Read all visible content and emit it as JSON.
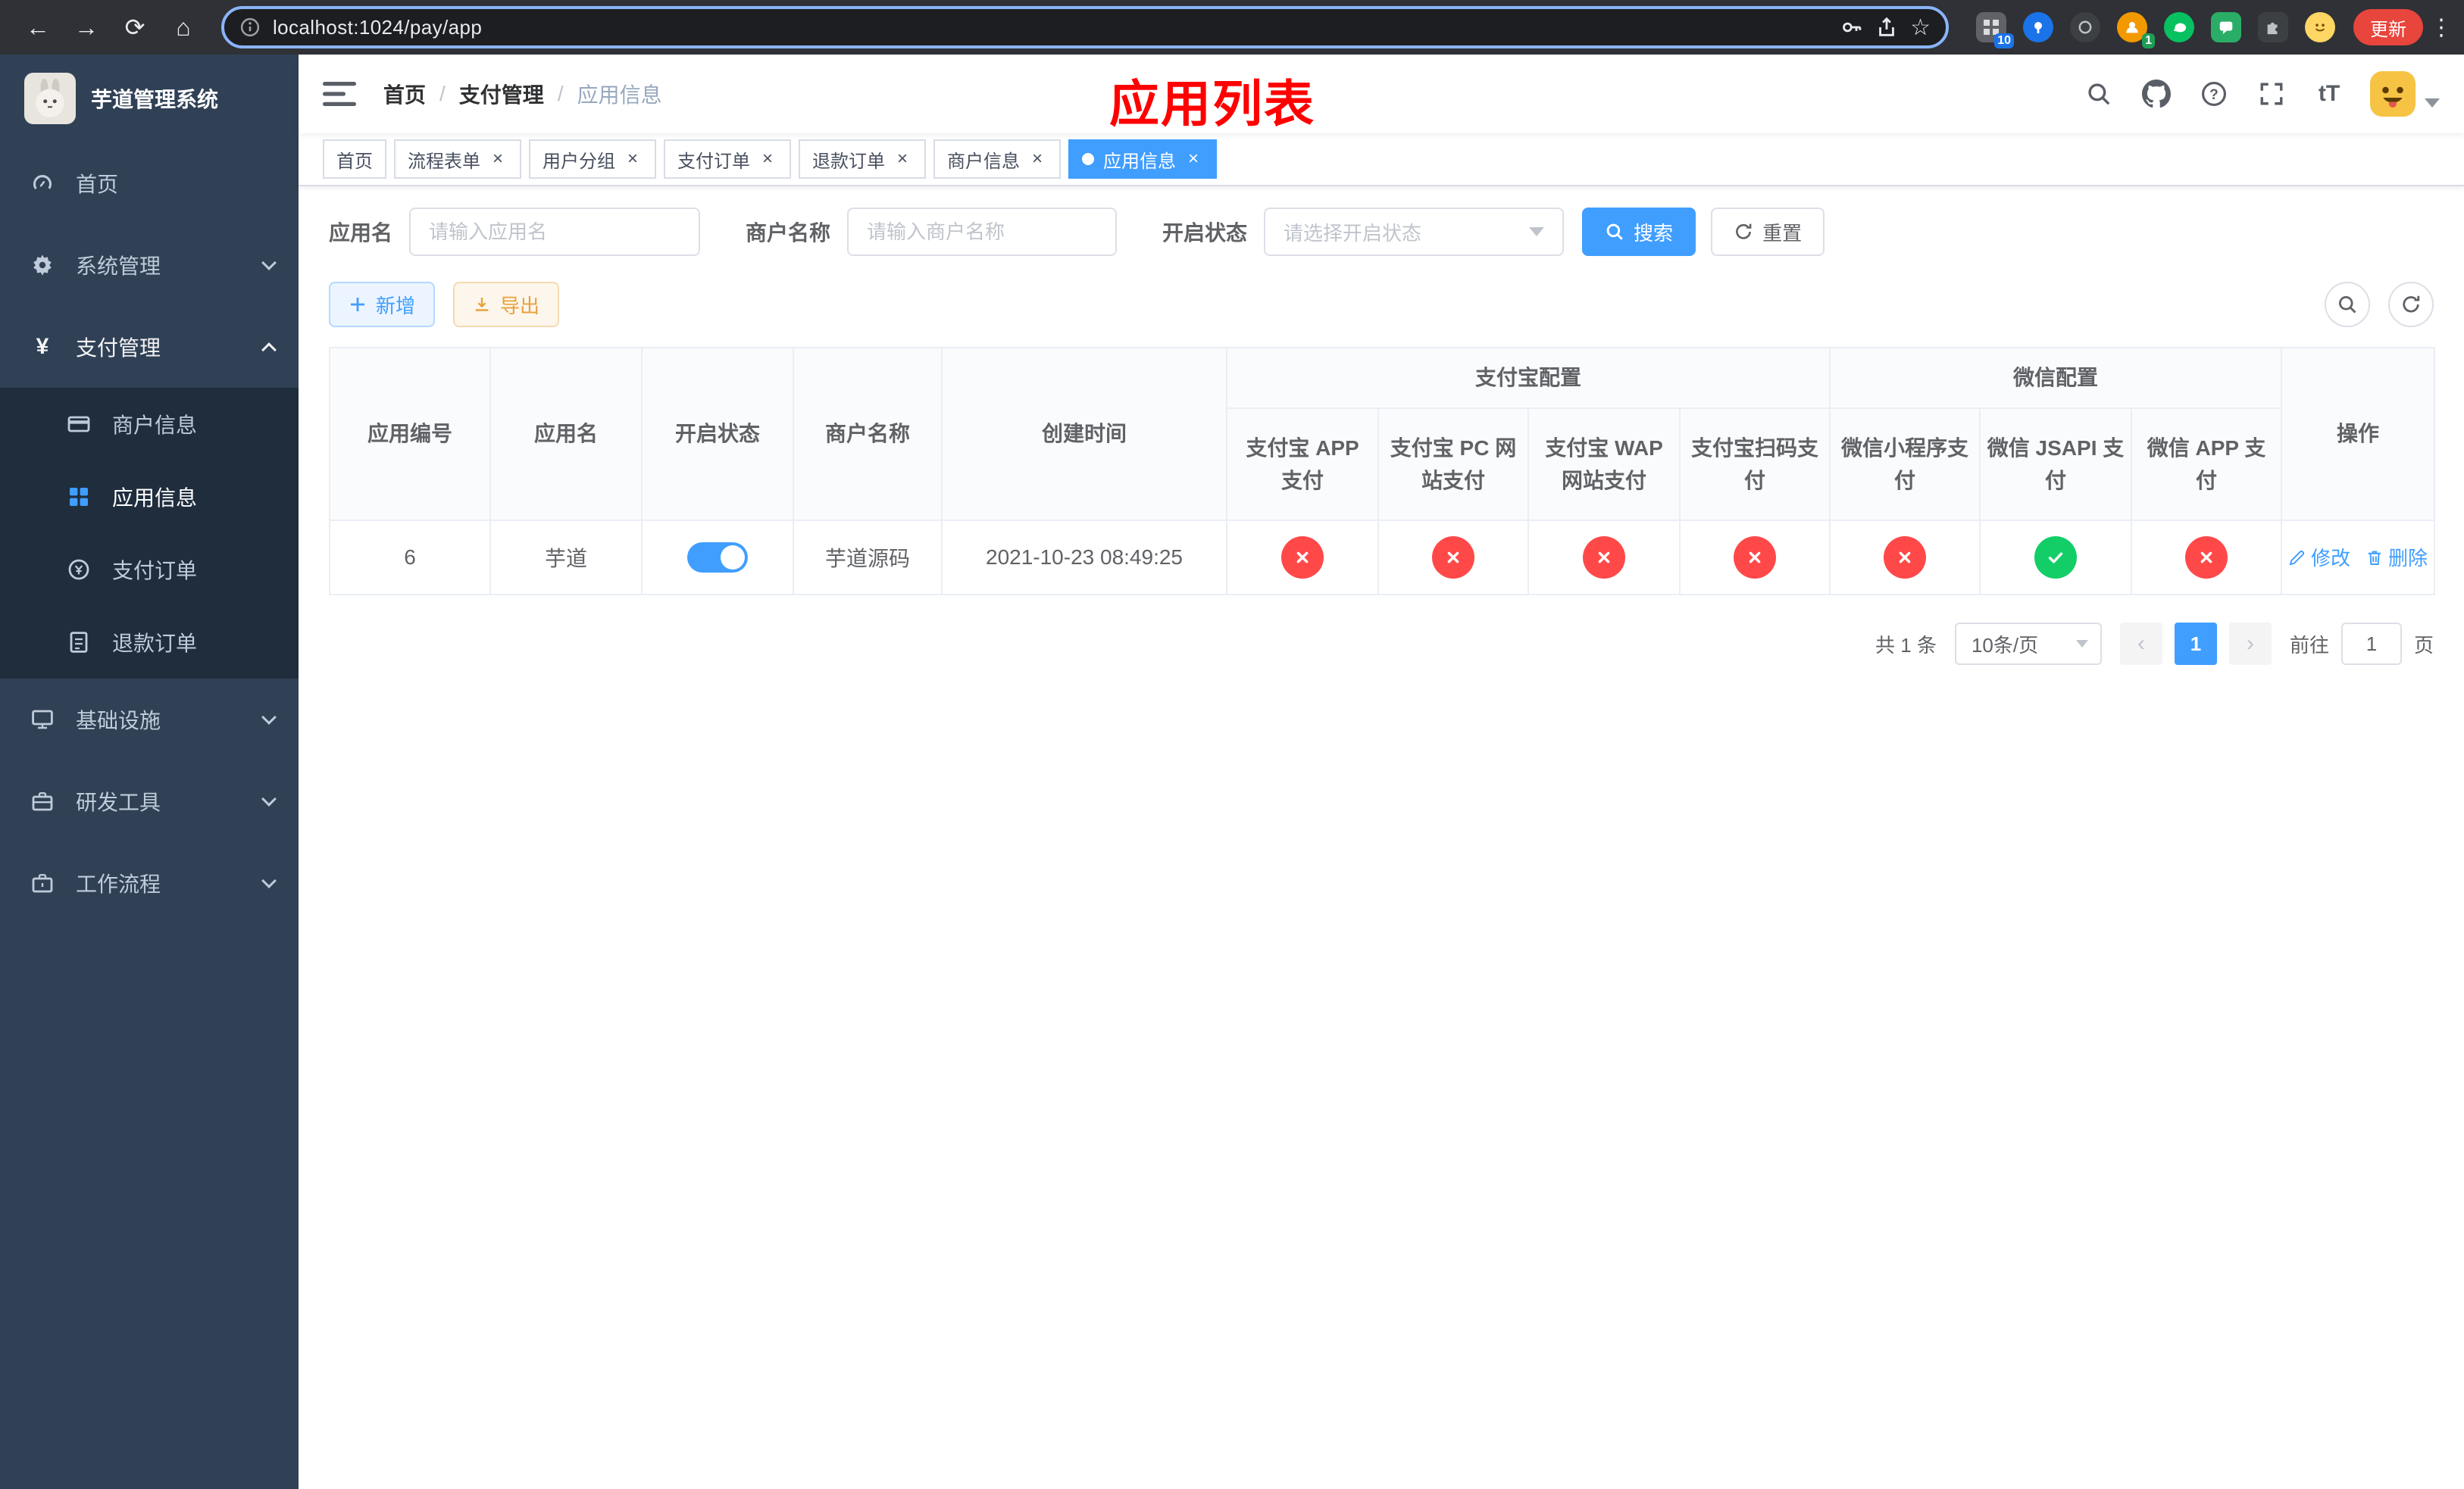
{
  "colors": {
    "accent": "#409eff",
    "danger": "#ff4949",
    "success": "#13ce66",
    "warning": "#e6a23c",
    "annotation": "#ff0000",
    "sidebar_bg": "#304156",
    "submenu_bg": "#1f2d3d"
  },
  "browser": {
    "url": "localhost:1024/pay/app",
    "update_label": "更新",
    "ext_badge_1": "10",
    "ext_badge_2": "1"
  },
  "sidebar": {
    "logo_title": "芋道管理系统",
    "items": [
      {
        "label": "首页"
      },
      {
        "label": "系统管理"
      },
      {
        "label": "支付管理",
        "children": [
          {
            "label": "商户信息"
          },
          {
            "label": "应用信息"
          },
          {
            "label": "支付订单"
          },
          {
            "label": "退款订单"
          }
        ]
      },
      {
        "label": "基础设施"
      },
      {
        "label": "研发工具"
      },
      {
        "label": "工作流程"
      }
    ]
  },
  "navbar": {
    "breadcrumb": [
      "首页",
      "支付管理",
      "应用信息"
    ],
    "annotation": "应用列表"
  },
  "tabs": [
    {
      "label": "首页"
    },
    {
      "label": "流程表单"
    },
    {
      "label": "用户分组"
    },
    {
      "label": "支付订单"
    },
    {
      "label": "退款订单"
    },
    {
      "label": "商户信息"
    },
    {
      "label": "应用信息"
    }
  ],
  "filters": {
    "app_name_label": "应用名",
    "app_name_placeholder": "请输入应用名",
    "merchant_label": "商户名称",
    "merchant_placeholder": "请输入商户名称",
    "status_label": "开启状态",
    "status_placeholder": "请选择开启状态",
    "search_label": "搜索",
    "reset_label": "重置"
  },
  "toolbar": {
    "add_label": "新增",
    "export_label": "导出"
  },
  "table": {
    "group_headers": {
      "alipay": "支付宝配置",
      "wechat": "微信配置"
    },
    "columns": [
      "应用编号",
      "应用名",
      "开启状态",
      "商户名称",
      "创建时间",
      "支付宝 APP 支付",
      "支付宝 PC 网站支付",
      "支付宝 WAP 网站支付",
      "支付宝扫码支付",
      "微信小程序支付",
      "微信 JSAPI 支付",
      "微信 APP 支付",
      "操作"
    ],
    "rows": [
      {
        "id": "6",
        "name": "芋道",
        "enabled": true,
        "merchant": "芋道源码",
        "created": "2021-10-23 08:49:25",
        "statuses": [
          "fail",
          "fail",
          "fail",
          "fail",
          "fail",
          "success",
          "fail"
        ],
        "edit_label": "修改",
        "delete_label": "删除"
      }
    ]
  },
  "pagination": {
    "total_text": "共 1 条",
    "page_size": "10条/页",
    "current_page": "1",
    "goto_prefix": "前往",
    "goto_value": "1",
    "goto_suffix": "页"
  }
}
